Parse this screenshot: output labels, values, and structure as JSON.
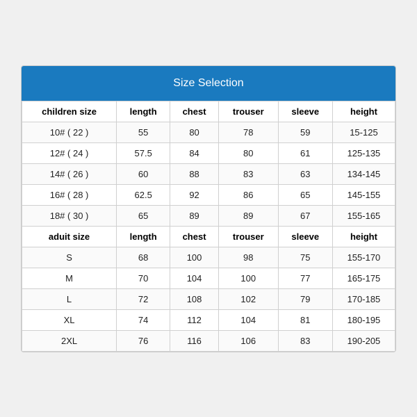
{
  "title": "Size Selection",
  "columns": [
    "children size",
    "length",
    "chest",
    "trouser",
    "sleeve",
    "height"
  ],
  "adult_columns": [
    "aduit size",
    "length",
    "chest",
    "trouser",
    "sleeve",
    "height"
  ],
  "children_rows": [
    {
      "size": "10# ( 22 )",
      "length": "55",
      "chest": "80",
      "trouser": "78",
      "sleeve": "59",
      "height": "15-125"
    },
    {
      "size": "12# ( 24 )",
      "length": "57.5",
      "chest": "84",
      "trouser": "80",
      "sleeve": "61",
      "height": "125-135"
    },
    {
      "size": "14# ( 26 )",
      "length": "60",
      "chest": "88",
      "trouser": "83",
      "sleeve": "63",
      "height": "134-145"
    },
    {
      "size": "16# ( 28 )",
      "length": "62.5",
      "chest": "92",
      "trouser": "86",
      "sleeve": "65",
      "height": "145-155"
    },
    {
      "size": "18# ( 30 )",
      "length": "65",
      "chest": "89",
      "trouser": "89",
      "sleeve": "67",
      "height": "155-165"
    }
  ],
  "adult_rows": [
    {
      "size": "S",
      "length": "68",
      "chest": "100",
      "trouser": "98",
      "sleeve": "75",
      "height": "155-170"
    },
    {
      "size": "M",
      "length": "70",
      "chest": "104",
      "trouser": "100",
      "sleeve": "77",
      "height": "165-175"
    },
    {
      "size": "L",
      "length": "72",
      "chest": "108",
      "trouser": "102",
      "sleeve": "79",
      "height": "170-185"
    },
    {
      "size": "XL",
      "length": "74",
      "chest": "112",
      "trouser": "104",
      "sleeve": "81",
      "height": "180-195"
    },
    {
      "size": "2XL",
      "length": "76",
      "chest": "116",
      "trouser": "106",
      "sleeve": "83",
      "height": "190-205"
    }
  ]
}
